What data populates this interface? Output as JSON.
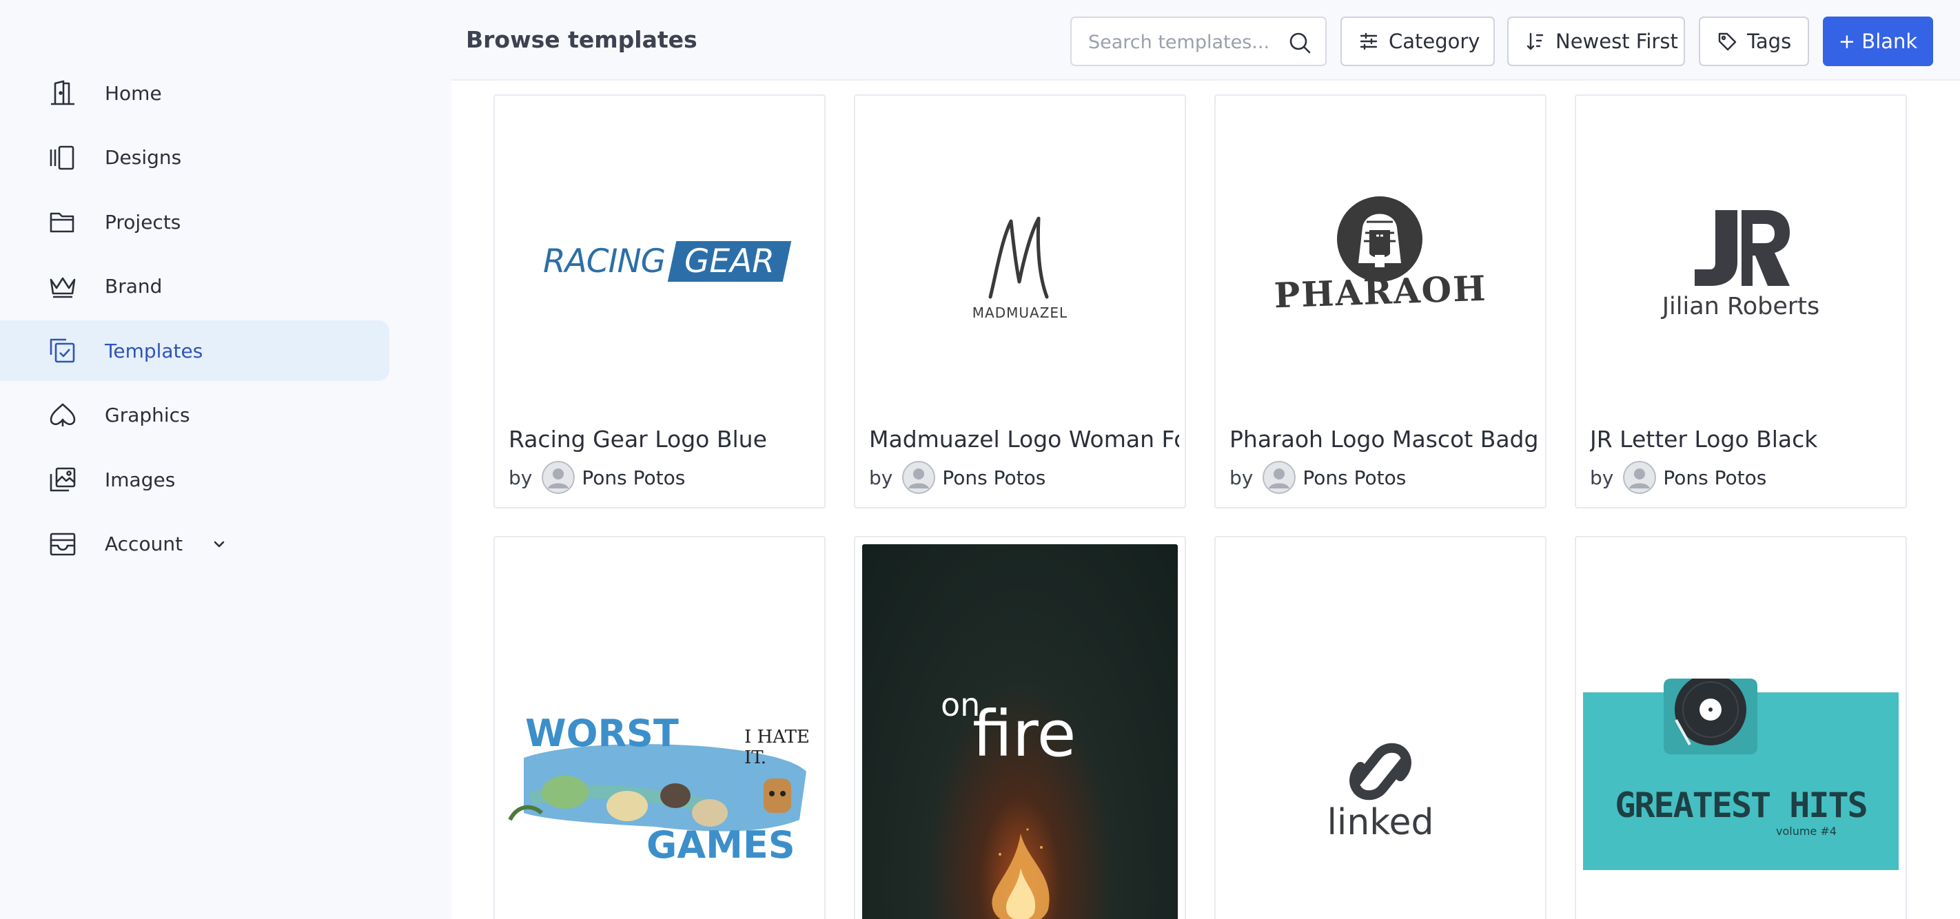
{
  "sidebar": {
    "items": [
      {
        "label": "Home",
        "icon": "home-icon"
      },
      {
        "label": "Designs",
        "icon": "designs-icon"
      },
      {
        "label": "Projects",
        "icon": "folder-icon"
      },
      {
        "label": "Brand",
        "icon": "crown-icon"
      },
      {
        "label": "Templates",
        "icon": "templates-icon",
        "active": true
      },
      {
        "label": "Graphics",
        "icon": "graphics-icon"
      },
      {
        "label": "Images",
        "icon": "images-icon"
      },
      {
        "label": "Account",
        "icon": "account-icon",
        "expandable": true
      }
    ]
  },
  "header": {
    "title": "Browse templates",
    "search_placeholder": "Search templates...",
    "category_label": "Category",
    "sort_label": "Newest First",
    "tags_label": "Tags",
    "blank_label": "+ Blank"
  },
  "templates": [
    {
      "title": "Racing Gear Logo Blue",
      "by": "by",
      "author": "Pons Potos",
      "thumb": {
        "word1": "RACING",
        "word2": "GEAR"
      }
    },
    {
      "title": "Madmuazel Logo Woman Fo",
      "by": "by",
      "author": "Pons Potos",
      "thumb": {
        "text": "MADMUAZEL"
      }
    },
    {
      "title": "Pharaoh Logo Mascot Badge",
      "by": "by",
      "author": "Pons Potos",
      "thumb": {
        "text": "PHARAOH"
      }
    },
    {
      "title": "JR Letter Logo Black",
      "by": "by",
      "author": "Pons Potos",
      "thumb": {
        "text": "Jilian Roberts"
      }
    },
    {
      "title": "",
      "thumb": {
        "top": "WORST",
        "bottom": "GAMES",
        "side": "I HATE IT."
      }
    },
    {
      "title": "",
      "thumb": {
        "on": "on",
        "word": "fire"
      }
    },
    {
      "title": "",
      "thumb": {
        "text": "linked"
      }
    },
    {
      "title": "",
      "thumb": {
        "text": "GREATEST HITS",
        "sub": "volume #4"
      }
    }
  ],
  "colors": {
    "accent": "#3563e6",
    "active_nav_bg": "#e6f0fb",
    "active_nav_text": "#2f54b8"
  }
}
